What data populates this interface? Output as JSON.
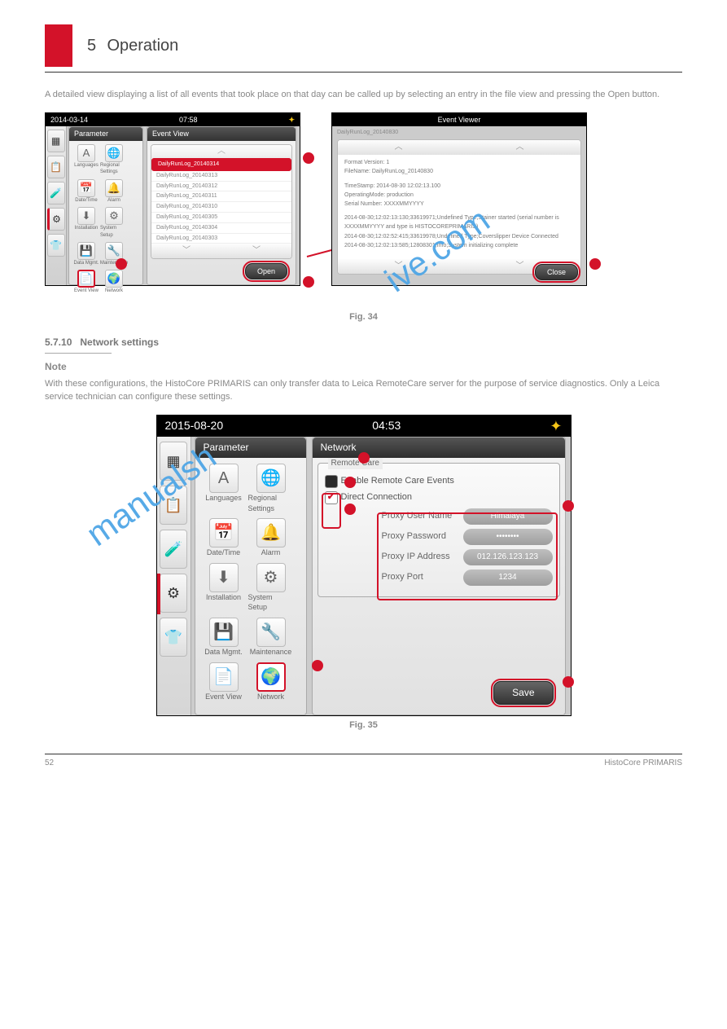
{
  "header": {
    "chapter_num": "5",
    "chapter_title": "Operation"
  },
  "intro_text": "A detailed view displaying a list of all events that took place on that day can be called up by selecting an entry in the file view and pressing the Open button.",
  "fig34": {
    "left": {
      "date": "2014-03-14",
      "time": "07:58",
      "panel_param": "Parameter",
      "panel_event": "Event View",
      "icons": {
        "languages": "Languages",
        "regional": "Regional Settings",
        "datetime": "Date/Time",
        "alarm": "Alarm",
        "installation": "Installation",
        "system": "System Setup",
        "datamgt": "Data Mgmt.",
        "maint": "Maintenance",
        "eventview": "Event View",
        "network": "Network"
      },
      "events": [
        "DailyRunLog_20140314",
        "DailyRunLog_20140313",
        "DailyRunLog_20140312",
        "DailyRunLog_20140311",
        "DailyRunLog_20140310",
        "DailyRunLog_20140305",
        "DailyRunLog_20140304",
        "DailyRunLog_20140303"
      ],
      "open_btn": "Open"
    },
    "right": {
      "title": "Event Viewer",
      "file_line": "DailyRunLog_20140830",
      "content": [
        "Format Version: 1",
        "FileName: DailyRunLog_20140830",
        "",
        "TimeStamp: 2014-08-30 12:02:13.100",
        "OperatingMode: production",
        "Serial Number: XXXXMMYYYY",
        "",
        "2014-08-30;12:02:13:130;33619971;Undefined Type;Stainer started (serial number is XXXXMMYYYY and type is HISTOCOREPRIMARIS)",
        "2014-08-30;12:02:52:415;33619978;Undefined Type;Coverslipper Device Connected",
        "2014-08-30;12:02:13:585;12808301;Info;System initializing complete"
      ],
      "close_btn": "Close"
    },
    "caption": "Fig. 34"
  },
  "section": {
    "num": "5.7.10",
    "title": "Network settings"
  },
  "note_title": "Note",
  "note_body": "With these configurations, the HistoCore PRIMARIS can only transfer data to Leica RemoteCare server for the purpose of service diagnostics. Only a Leica service technician can configure these settings.",
  "fig35": {
    "date": "2015-08-20",
    "time": "04:53",
    "panel_param": "Parameter",
    "panel_network": "Network",
    "icons": {
      "languages": "Languages",
      "regional": "Regional Settings",
      "datetime": "Date/Time",
      "alarm": "Alarm",
      "installation": "Installation",
      "system": "System Setup",
      "datamgt": "Data Mgmt.",
      "maint": "Maintenance",
      "eventview": "Event View",
      "network": "Network"
    },
    "remote_legend": "Remote Care",
    "enable_label": "Enable Remote Care Events",
    "direct_label": "Direct Connection",
    "fields": {
      "user_lbl": "Proxy User Name",
      "user_val": "Himalaya",
      "pwd_lbl": "Proxy Password",
      "pwd_val": "••••••••",
      "ip_lbl": "Proxy IP Address",
      "ip_val": "012.126.123.123",
      "port_lbl": "Proxy Port",
      "port_val": "1234"
    },
    "save_btn": "Save",
    "caption": "Fig. 35"
  },
  "footer": {
    "page": "52",
    "doc": "HistoCore PRIMARIS"
  },
  "watermark": "manualshive.com"
}
